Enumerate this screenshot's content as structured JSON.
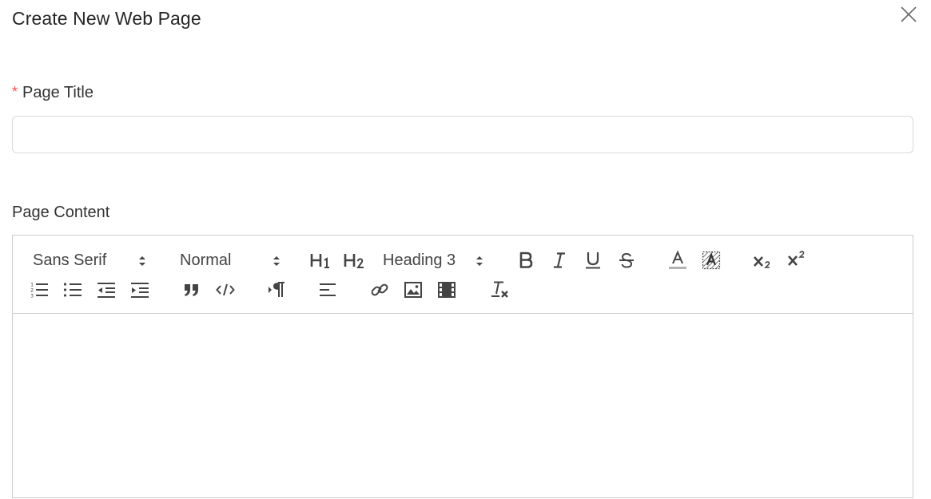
{
  "dialog": {
    "title": "Create New Web Page"
  },
  "fields": {
    "page_title": {
      "label": "Page Title",
      "required_mark": "*",
      "value": "",
      "placeholder": ""
    },
    "page_content": {
      "label": "Page Content"
    }
  },
  "toolbar": {
    "font_picker": "Sans Serif",
    "size_picker": "Normal",
    "header_picker": "Heading 3",
    "h1_label": "H1",
    "h2_label": "H2"
  },
  "icons": [
    "close-icon",
    "chevron-updown-icon",
    "h1-icon",
    "h2-icon",
    "bold-icon",
    "italic-icon",
    "underline-icon",
    "strike-icon",
    "text-color-icon",
    "background-color-icon",
    "subscript-icon",
    "superscript-icon",
    "ordered-list-icon",
    "bullet-list-icon",
    "outdent-icon",
    "indent-icon",
    "blockquote-icon",
    "code-block-icon",
    "text-direction-icon",
    "align-icon",
    "link-icon",
    "image-icon",
    "video-icon",
    "clear-format-icon"
  ],
  "colors": {
    "required": "#ff4d4f",
    "border": "#d9d9d9",
    "toolbar_icon": "#444444"
  }
}
